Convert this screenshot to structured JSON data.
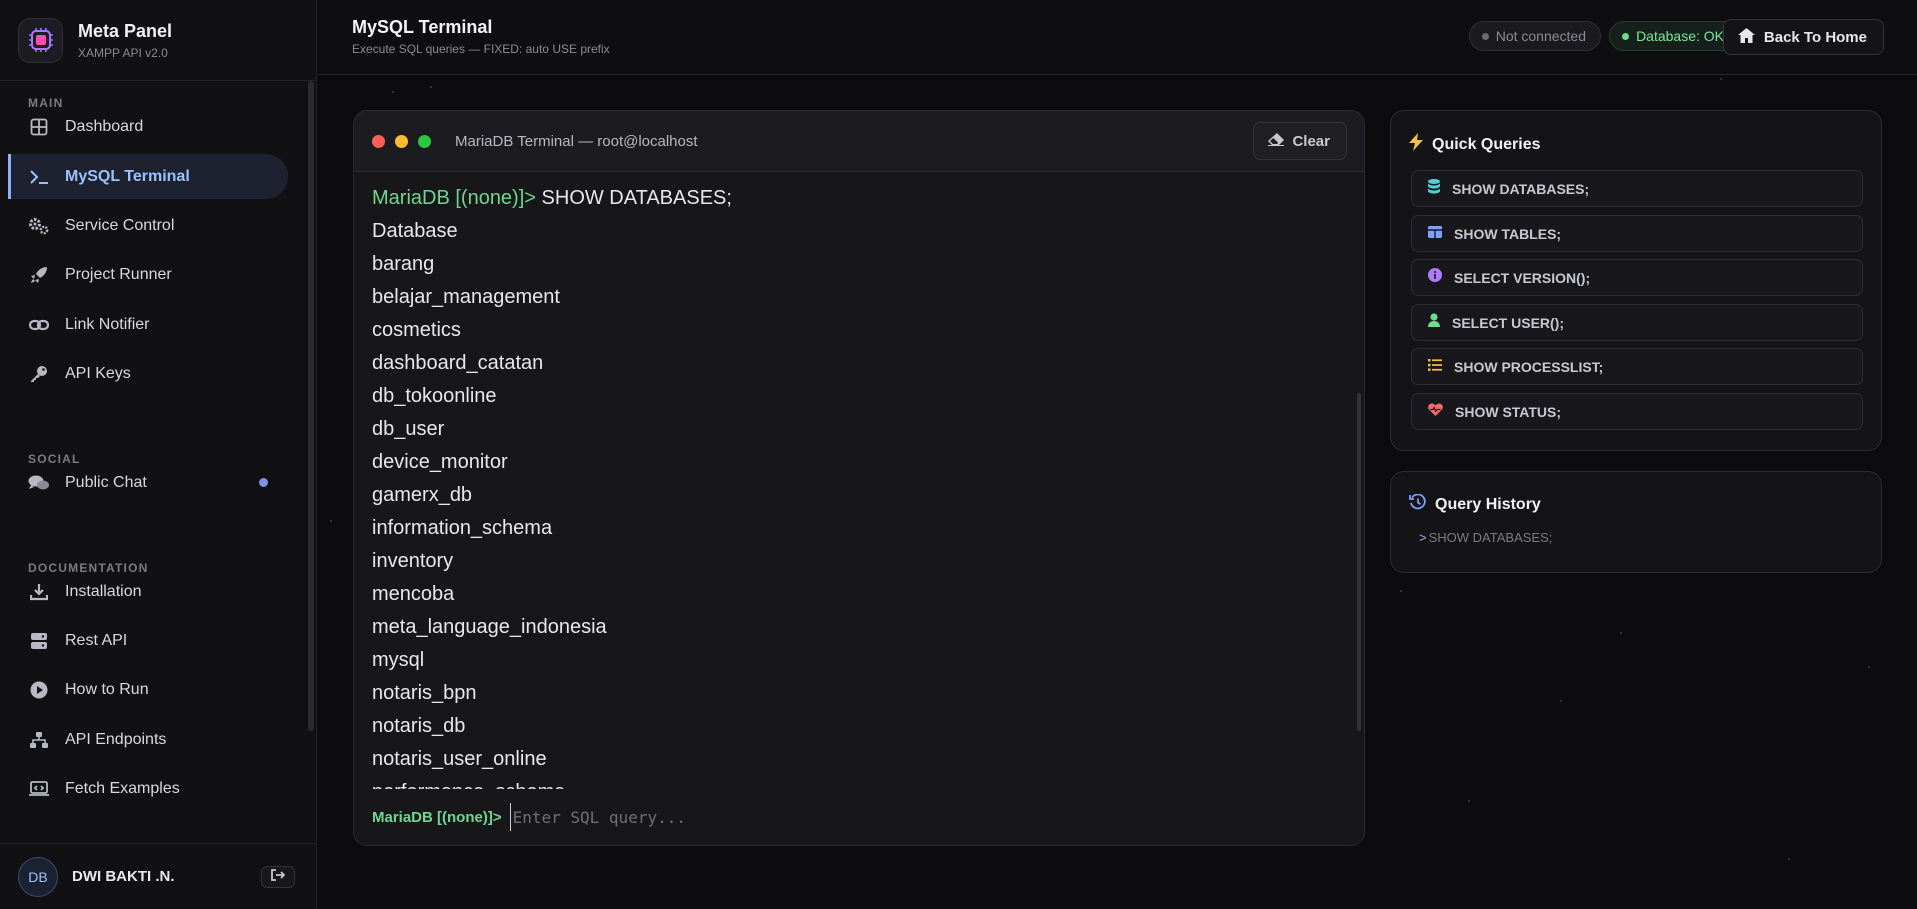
{
  "brand": {
    "title": "Meta Panel",
    "subtitle": "XAMPP API v2.0"
  },
  "sidebar": {
    "sections": [
      {
        "label": "MAIN"
      },
      {
        "label": "SOCIAL"
      },
      {
        "label": "DOCUMENTATION"
      }
    ],
    "items": [
      {
        "label": "Dashboard",
        "icon": "grid-icon"
      },
      {
        "label": "MySQL Terminal",
        "icon": "terminal-icon",
        "active": true
      },
      {
        "label": "Service Control",
        "icon": "gears-icon"
      },
      {
        "label": "Project Runner",
        "icon": "rocket-icon"
      },
      {
        "label": "Link Notifier",
        "icon": "link-icon"
      },
      {
        "label": "API Keys",
        "icon": "key-icon"
      },
      {
        "label": "Public Chat",
        "icon": "chat-icon",
        "badge_color": "#7b95e6"
      },
      {
        "label": "Installation",
        "icon": "download-icon"
      },
      {
        "label": "Rest API",
        "icon": "server-icon"
      },
      {
        "label": "How to Run",
        "icon": "play-icon"
      },
      {
        "label": "API Endpoints",
        "icon": "sitemap-icon"
      },
      {
        "label": "Fetch Examples",
        "icon": "laptop-code-icon"
      }
    ]
  },
  "user": {
    "initials": "DB",
    "name": "DWI BAKTI .N."
  },
  "header": {
    "title": "MySQL Terminal",
    "subtitle": "Execute SQL queries — FIXED: auto USE prefix",
    "status_connection": "Not connected",
    "status_database": "Database: OK",
    "home_label": "Back To Home"
  },
  "terminal": {
    "title": "MariaDB Terminal — root@localhost",
    "clear_label": "Clear",
    "prompt": "MariaDB [(none)]>",
    "command": "SHOW DATABASES;",
    "output": [
      "Database",
      "barang",
      "belajar_management",
      "cosmetics",
      "dashboard_catatan",
      "db_tokoonline",
      "db_user",
      "device_monitor",
      "gamerx_db",
      "information_schema",
      "inventory",
      "mencoba",
      "meta_language_indonesia",
      "mysql",
      "notaris_bpn",
      "notaris_db",
      "notaris_user_online",
      "performance_schema"
    ],
    "input_prompt": "MariaDB [(none)]>",
    "input_placeholder": "Enter SQL query...",
    "input_value": ""
  },
  "quick_queries": {
    "title": "Quick Queries",
    "items": [
      {
        "label": "SHOW DATABASES;",
        "icon": "database-icon",
        "color": "#4fd1d9"
      },
      {
        "label": "SHOW TABLES;",
        "icon": "table-icon",
        "color": "#7aa2ff"
      },
      {
        "label": "SELECT VERSION();",
        "icon": "info-icon",
        "color": "#b07bff"
      },
      {
        "label": "SELECT USER();",
        "icon": "user-icon",
        "color": "#6ddc8f"
      },
      {
        "label": "SHOW PROCESSLIST;",
        "icon": "list-icon",
        "color": "#f5c04a"
      },
      {
        "label": "SHOW STATUS;",
        "icon": "heartbeat-icon",
        "color": "#ff6b6b"
      }
    ]
  },
  "query_history": {
    "title": "Query History",
    "items": [
      {
        "marker": ">",
        "label": "SHOW DATABASES;"
      }
    ]
  },
  "colors": {
    "accent": "#8fb0ff",
    "prompt_green": "#6ed68f",
    "background": "#0c0c0e"
  }
}
